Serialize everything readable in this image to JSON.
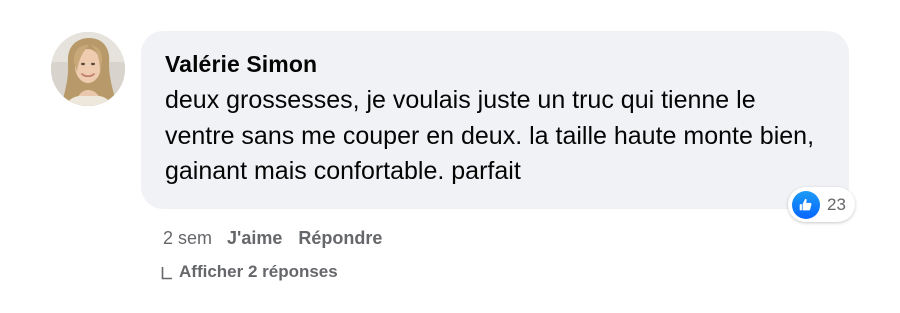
{
  "comment": {
    "author": "Valérie Simon",
    "text": "deux grossesses, je voulais juste un truc qui tienne le ventre sans me couper en deux. la taille haute monte bien, gainant mais confortable. parfait",
    "reactions": {
      "icon": "thumbs-up-icon",
      "count": "23",
      "color": "#0866ff"
    },
    "timestamp": "2 sem",
    "like_label": "J'aime",
    "reply_label": "Répondre",
    "replies_label": "Afficher 2 réponses"
  },
  "colors": {
    "bubble": "#f0f2f5",
    "text": "#050505",
    "secondary": "#65676b"
  }
}
